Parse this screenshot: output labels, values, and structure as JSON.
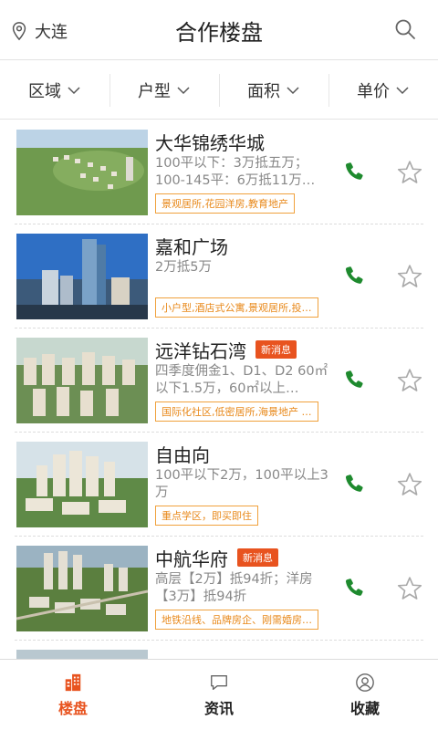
{
  "header": {
    "city": "大连",
    "title": "合作楼盘"
  },
  "filters": [
    {
      "label": "区域"
    },
    {
      "label": "户型"
    },
    {
      "label": "面积"
    },
    {
      "label": "单价"
    }
  ],
  "listings": [
    {
      "name": "大华锦绣华城",
      "badge": "",
      "desc": "100平以下：3万抵五万；100-145平：6万抵11万…",
      "tags": "景观居所,花园洋房,教育地产"
    },
    {
      "name": "嘉和广场",
      "badge": "",
      "desc": "2万抵5万",
      "tags": "小户型,酒店式公寓,景观居所,投…"
    },
    {
      "name": "远洋钻石湾",
      "badge": "新消息",
      "desc": "四季度佣金1、D1、D2 60㎡以下1.5万，60㎡以上…",
      "tags": "国际化社区,低密居所,海景地产 …"
    },
    {
      "name": "自由向",
      "badge": "",
      "desc": "100平以下2万，100平以上3万",
      "tags": "重点学区，即买即住"
    },
    {
      "name": "中航华府",
      "badge": "新消息",
      "desc": "高层【2万】抵94折；洋房【3万】抵94折",
      "tags": "地铁沿线、品牌房企、刚需婚房…"
    }
  ],
  "tabbar": [
    {
      "label": "楼盘",
      "icon": "building-icon"
    },
    {
      "label": "资讯",
      "icon": "chat-icon"
    },
    {
      "label": "收藏",
      "icon": "user-circle-icon"
    }
  ],
  "colors": {
    "accent": "#e8531f",
    "tag": "#f0a13c",
    "phone": "#1e8a2e"
  }
}
